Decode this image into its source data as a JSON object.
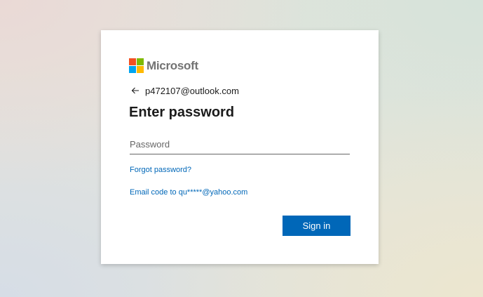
{
  "brand": {
    "name": "Microsoft",
    "logo_colors": [
      "#f25022",
      "#7fba00",
      "#00a4ef",
      "#ffb900"
    ]
  },
  "identity": {
    "email": "p472107@outlook.com",
    "back_icon": "back-arrow-icon"
  },
  "form": {
    "title": "Enter password",
    "password_placeholder": "Password",
    "password_value": "",
    "forgot_link": "Forgot password?",
    "email_code_link": "Email code to qu*****@yahoo.com",
    "signin_label": "Sign in"
  },
  "colors": {
    "accent": "#0067b8",
    "text": "#1b1b1b"
  }
}
